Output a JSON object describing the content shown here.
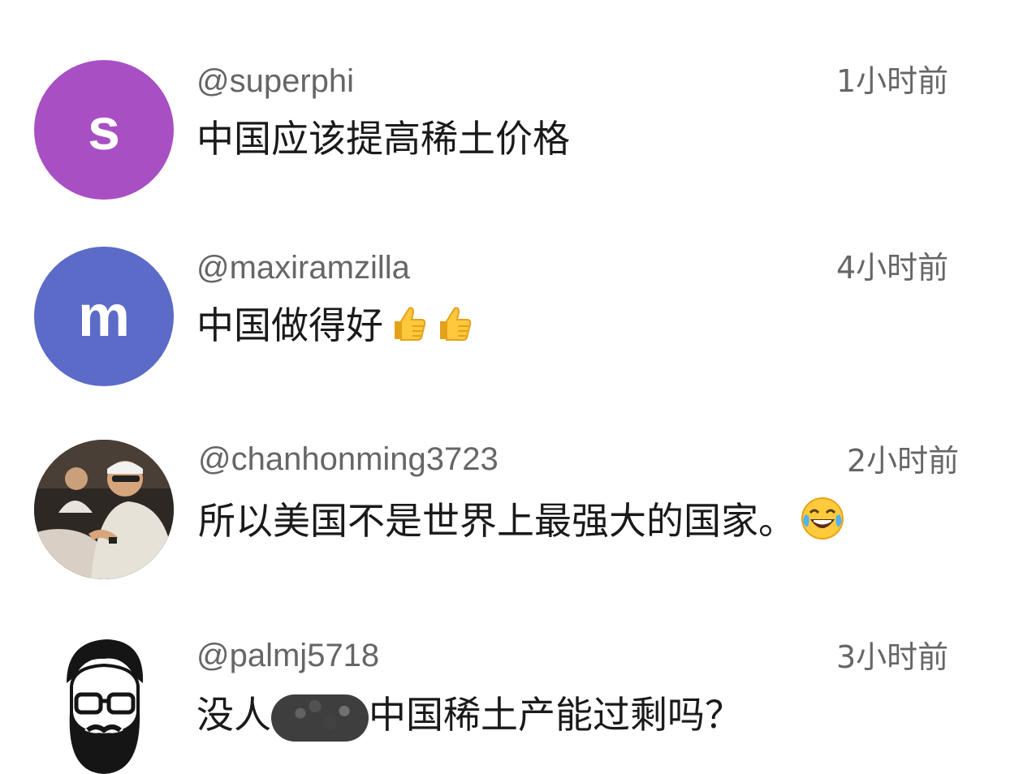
{
  "comments": [
    {
      "avatar_letter": "s",
      "avatar_color": "#A84FC4",
      "handle": "@superphi",
      "time": "1小时前",
      "text": "中国应该提高稀土价格"
    },
    {
      "avatar_letter": "m",
      "avatar_color": "#5C6BC8",
      "handle": "@maxiramzilla",
      "time": "4小时前",
      "text": "中国做得好"
    },
    {
      "avatar_type": "photo",
      "handle": "@chanhonming3723",
      "time": "2小时前",
      "text": "所以美国不是世界上最强大的国家。"
    },
    {
      "avatar_type": "illustration",
      "handle": "@palmj5718",
      "time": "3小时前",
      "text_before": "没人",
      "text_after": "中国稀土产能过剩吗？"
    }
  ],
  "icons": {
    "thumbs_up": "thumbs-up-icon",
    "laughing": "face-with-tears-of-joy-icon"
  }
}
